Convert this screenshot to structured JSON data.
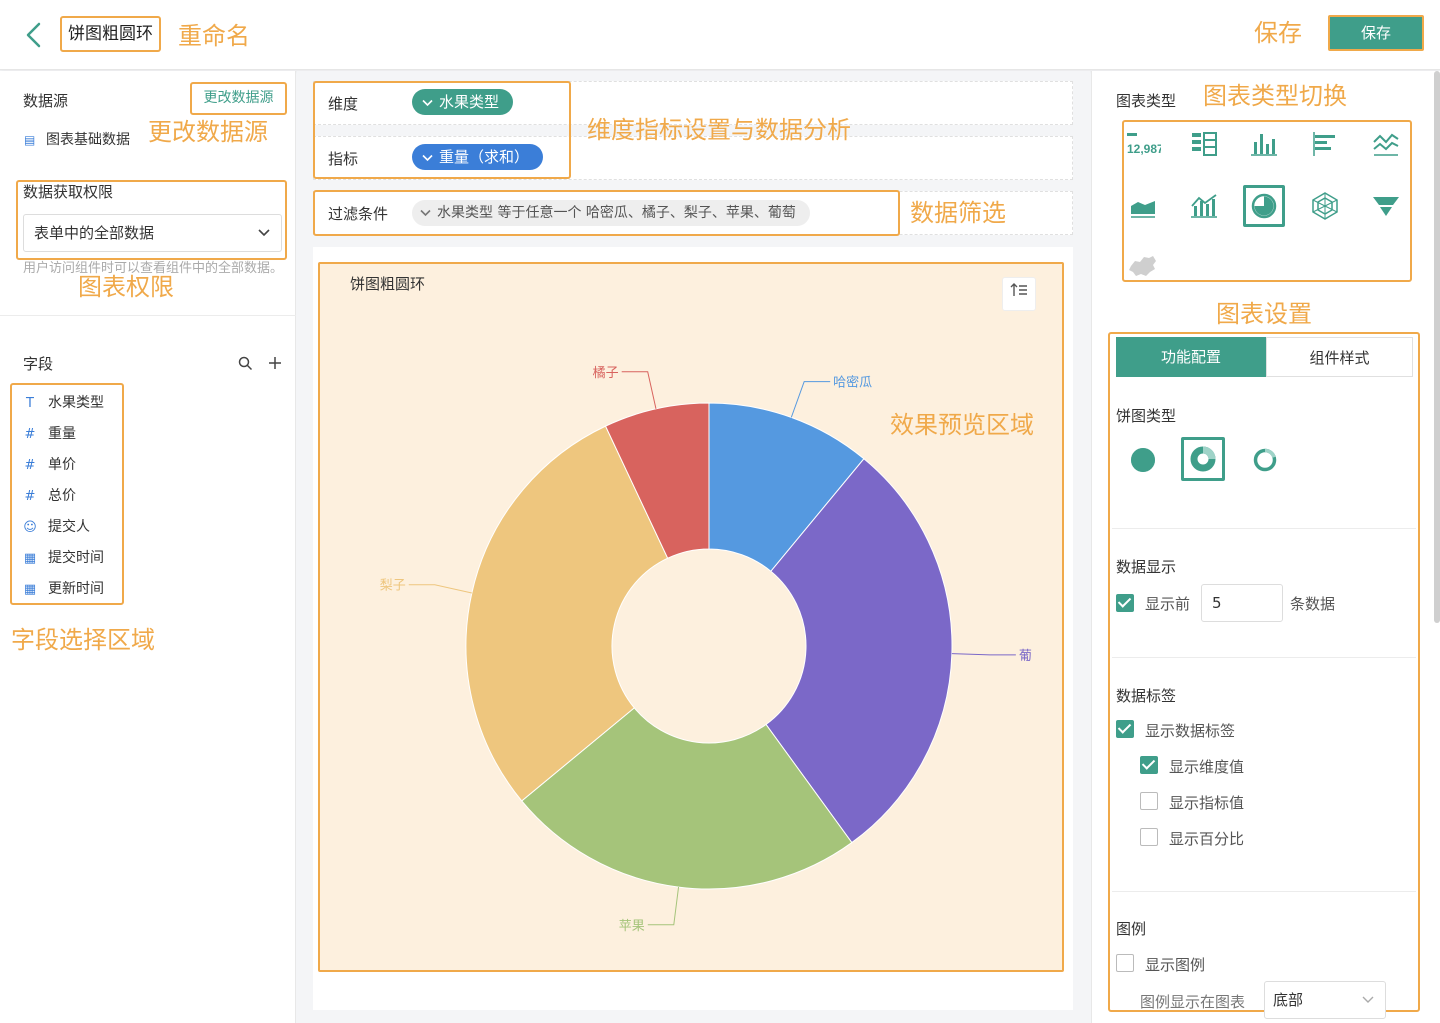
{
  "header": {
    "chart_name": "饼图粗圆环",
    "anno_rename": "重命名",
    "anno_save": "保存",
    "save_label": "保存"
  },
  "left": {
    "datasource_title": "数据源",
    "change_datasource_label": "更改数据源",
    "anno_change_datasource": "更改数据源",
    "datasource_name": "图表基础数据",
    "permission_title": "数据获取权限",
    "permission_value": "表单中的全部数据",
    "permission_hint": "用户访问组件时可以查看组件中的全部数据。",
    "anno_permission": "图表权限",
    "fields_title": "字段",
    "fields": [
      {
        "icon": "T",
        "label": "水果类型"
      },
      {
        "icon": "#",
        "label": "重量"
      },
      {
        "icon": "#",
        "label": "单价"
      },
      {
        "icon": "#",
        "label": "总价"
      },
      {
        "icon": "user",
        "label": "提交人"
      },
      {
        "icon": "calendar",
        "label": "提交时间"
      },
      {
        "icon": "calendar",
        "label": "更新时间"
      }
    ],
    "anno_fields": "字段选择区域"
  },
  "center": {
    "dimension_label": "维度",
    "dimension_value": "水果类型",
    "metric_label": "指标",
    "metric_value": "重量（求和）",
    "anno_config": "维度指标设置与数据分析",
    "filter_label": "过滤条件",
    "filter_value": "水果类型 等于任意一个 哈密瓜、橘子、梨子、苹果、葡萄",
    "anno_filter": "数据筛选",
    "preview_title": "饼图粗圆环",
    "anno_preview": "效果预览区域"
  },
  "chart_data": {
    "type": "pie",
    "variant": "thick-donut",
    "categories": [
      "哈密瓜",
      "葡",
      "苹果",
      "梨子",
      "橘子"
    ],
    "values": [
      11,
      29,
      24,
      29,
      7
    ],
    "colors": [
      "#5599e0",
      "#7b68c8",
      "#a5c47a",
      "#eec67e",
      "#d8635e"
    ],
    "legend": "hidden"
  },
  "right": {
    "chart_type_title": "图表类型",
    "anno_chart_switch": "图表类型切换",
    "anno_chart_settings": "图表设置",
    "kpi_sample": "12,987",
    "tab_config": "功能配置",
    "tab_style": "组件样式",
    "pie_type_title": "饼图类型",
    "data_display_title": "数据显示",
    "show_top_label": "显示前",
    "show_top_value": "5",
    "show_top_suffix": "条数据",
    "data_label_title": "数据标签",
    "show_data_label": "显示数据标签",
    "show_dim_value": "显示维度值",
    "show_metric_value": "显示指标值",
    "show_percent": "显示百分比",
    "legend_title": "图例",
    "show_legend": "显示图例",
    "legend_pos_label": "图例显示在图表",
    "legend_pos_value": "底部"
  },
  "colors": {
    "accent": "#3f9e8a",
    "annotation": "#f0a94a",
    "pill_dimension": "#3f9e8a",
    "pill_metric": "#3b7ed8"
  }
}
